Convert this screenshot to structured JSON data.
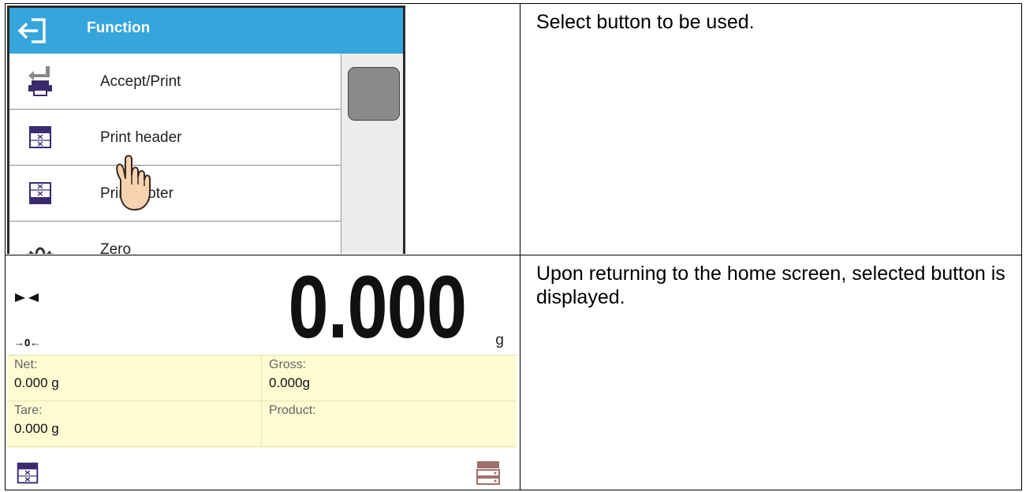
{
  "function_screen": {
    "title": "Function",
    "items": [
      {
        "label": "Accept/Print",
        "icon": "accept-print-icon"
      },
      {
        "label": "Print header",
        "icon": "print-header-icon"
      },
      {
        "label": "Print footer",
        "icon": "print-footer-icon"
      },
      {
        "label": "Zero",
        "icon": "zero-icon"
      }
    ],
    "header_color": "#35a5dc"
  },
  "home_screen": {
    "weight": "0.000",
    "unit": "g",
    "zero_indicator": "→0←",
    "info": [
      {
        "key": "Net:",
        "value": "0.000 g"
      },
      {
        "key": "Gross:",
        "value": "0.000g"
      },
      {
        "key": "Tare:",
        "value": "0.000 g"
      },
      {
        "key": "Product:",
        "value": ""
      }
    ],
    "info_bg_color": "#fffbd2"
  },
  "descriptions": {
    "step1": "Select button to be used.",
    "step2": "Upon returning to the home screen, selected button is displayed."
  }
}
